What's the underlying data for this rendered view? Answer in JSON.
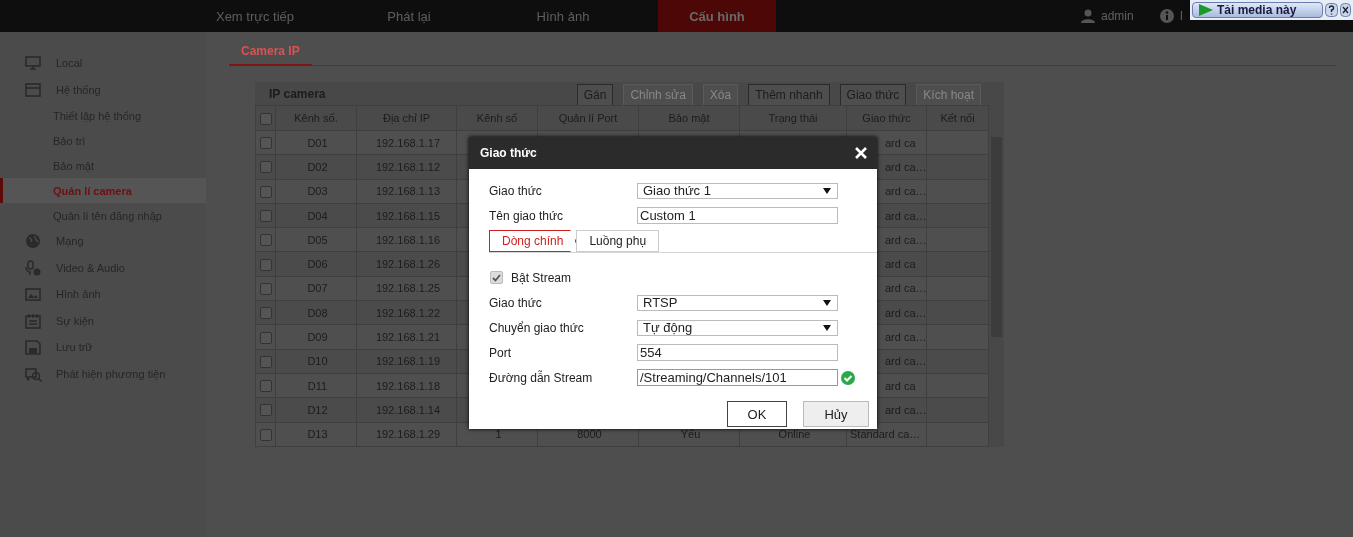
{
  "top_nav": {
    "tabs": [
      {
        "label": "Xem trực tiếp",
        "selected": false
      },
      {
        "label": "Phát lại",
        "selected": false
      },
      {
        "label": "Hình ảnh",
        "selected": false
      },
      {
        "label": "Cấu hình",
        "selected": true
      }
    ],
    "user": "admin",
    "info": "I"
  },
  "media_bar": {
    "label": "Tải media này"
  },
  "sidebar": {
    "items": [
      {
        "label": "Local",
        "selected": false
      },
      {
        "label": "Hệ thống",
        "selected": false,
        "children": [
          {
            "label": "Thiết lập hệ thống",
            "selected": false
          },
          {
            "label": "Bảo trì",
            "selected": false
          },
          {
            "label": "Bảo mật",
            "selected": false
          },
          {
            "label": "Quản lí camera",
            "selected": true
          },
          {
            "label": "Quản lí tên đăng nhập",
            "selected": false
          }
        ]
      },
      {
        "label": "Mạng",
        "selected": false
      },
      {
        "label": "Video & Audio",
        "selected": false
      },
      {
        "label": "Hình ảnh",
        "selected": false
      },
      {
        "label": "Sự kiện",
        "selected": false
      },
      {
        "label": "Lưu trữ",
        "selected": false
      },
      {
        "label": "Phát hiện phương tiện",
        "selected": false
      }
    ]
  },
  "content": {
    "tabs": [
      {
        "label": "Camera IP",
        "selected": true
      }
    ],
    "panel": {
      "title": "IP camera",
      "all_checked": false,
      "buttons": [
        {
          "label": "Gán",
          "disabled": false
        },
        {
          "label": "Chỉnh sửa",
          "disabled": true
        },
        {
          "label": "Xóa",
          "disabled": true
        },
        {
          "label": "Thêm nhanh",
          "disabled": false
        },
        {
          "label": "Giao thức",
          "disabled": false
        },
        {
          "label": "Kích hoạt",
          "disabled": true
        }
      ],
      "columns": [
        "Kênh số.",
        "Địa chỉ IP",
        "Kênh số",
        "Quản lí Port",
        "Bảo mật",
        "Trạng thái",
        "Giao thức",
        "Kết nối"
      ],
      "rows": [
        {
          "checked": false,
          "cells": [
            "D01",
            "192.168.1.17",
            null,
            null,
            null,
            null,
            "ard ca",
            null
          ]
        },
        {
          "checked": false,
          "cells": [
            "D02",
            "192.168.1.12",
            null,
            null,
            null,
            null,
            "ard ca…",
            null
          ]
        },
        {
          "checked": false,
          "cells": [
            "D03",
            "192.168.1.13",
            null,
            null,
            null,
            null,
            "ard ca…",
            null
          ]
        },
        {
          "checked": false,
          "cells": [
            "D04",
            "192.168.1.15",
            null,
            null,
            null,
            null,
            "ard ca…",
            null
          ]
        },
        {
          "checked": false,
          "cells": [
            "D05",
            "192.168.1.16",
            null,
            null,
            null,
            null,
            "ard ca…",
            null
          ]
        },
        {
          "checked": false,
          "cells": [
            "D06",
            "192.168.1.26",
            null,
            null,
            null,
            null,
            "ard ca",
            null
          ]
        },
        {
          "checked": false,
          "cells": [
            "D07",
            "192.168.1.25",
            null,
            null,
            null,
            null,
            "ard ca…",
            null
          ]
        },
        {
          "checked": false,
          "cells": [
            "D08",
            "192.168.1.22",
            null,
            null,
            null,
            null,
            "ard ca…",
            null
          ]
        },
        {
          "checked": false,
          "cells": [
            "D09",
            "192.168.1.21",
            null,
            null,
            null,
            null,
            "ard ca…",
            null
          ]
        },
        {
          "checked": false,
          "cells": [
            "D10",
            "192.168.1.19",
            null,
            null,
            null,
            null,
            "ard ca…",
            null
          ]
        },
        {
          "checked": false,
          "cells": [
            "D11",
            "192.168.1.18",
            null,
            null,
            null,
            null,
            "ard ca",
            null
          ]
        },
        {
          "checked": false,
          "cells": [
            "D12",
            "192.168.1.14",
            null,
            null,
            null,
            null,
            "ard ca…",
            null
          ]
        },
        {
          "checked": false,
          "cells": [
            "D13",
            "192.168.1.29",
            "1",
            "8000",
            "Yếu",
            "Online",
            "Standard ca…",
            null
          ]
        }
      ]
    }
  },
  "dialog": {
    "title": "Giao thức",
    "top_fields": [
      {
        "kind": "select",
        "label": "Giao thức",
        "value": "Giao thức 1"
      },
      {
        "kind": "input",
        "label": "Tên giao thức",
        "value": "Custom 1"
      }
    ],
    "tabs": [
      {
        "label": "Dòng chính",
        "selected": true
      },
      {
        "label": "Luồng phụ",
        "selected": false
      }
    ],
    "enable": {
      "label": "Bật Stream",
      "checked": true,
      "disabled": true
    },
    "fields": [
      {
        "kind": "select",
        "label": "Giao thức",
        "value": "RTSP"
      },
      {
        "kind": "select",
        "label": "Chuyển giao thức",
        "value": "Tự động"
      },
      {
        "kind": "input",
        "label": "Port",
        "value": "554"
      },
      {
        "kind": "input",
        "label": "Đường dẫn Stream",
        "value": "/Streaming/Channels/101",
        "focused": true,
        "valid": true
      }
    ],
    "buttons": [
      {
        "label": "OK",
        "kind": "primary"
      },
      {
        "label": "Hủy",
        "kind": "secondary"
      }
    ]
  }
}
